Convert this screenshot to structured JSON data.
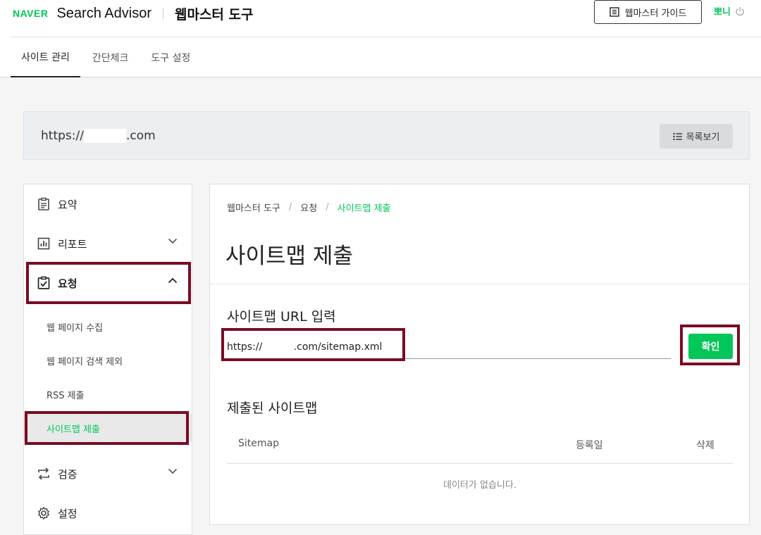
{
  "header": {
    "logo": "NAVER",
    "product": "Search Advisor",
    "section": "웹마스터 도구",
    "guide_label": "웹마스터 가이드",
    "user_name": "뽀니"
  },
  "tabs": [
    {
      "label": "사이트 관리",
      "active": true
    },
    {
      "label": "간단체크"
    },
    {
      "label": "도구 설정"
    }
  ],
  "site": {
    "url_prefix": "https://",
    "url_suffix": ".com",
    "list_button": "목록보기"
  },
  "sidebar": {
    "items": [
      {
        "label": "요약",
        "icon": "clipboard-icon"
      },
      {
        "label": "리포트",
        "icon": "chart-icon",
        "expandable": true
      },
      {
        "label": "요청",
        "icon": "checklist-icon",
        "expanded": true
      },
      {
        "label": "검증",
        "icon": "repeat-icon",
        "expandable": true
      },
      {
        "label": "설정",
        "icon": "gear-icon"
      }
    ],
    "subitems": [
      {
        "label": "웹 페이지 수집"
      },
      {
        "label": "웹 페이지 검색 제외"
      },
      {
        "label": "RSS 제출"
      },
      {
        "label": "사이트맵 제출",
        "active": true
      }
    ]
  },
  "main": {
    "breadcrumb": [
      "웹마스터 도구",
      "요청",
      "사이트맵 제출"
    ],
    "title": "사이트맵 제출",
    "input_label": "사이트맵 URL 입력",
    "input_value": "https://          .com/sitemap.xml",
    "submit_label": "확인",
    "submitted_title": "제출된 사이트맵",
    "columns": [
      "Sitemap",
      "등록일",
      "삭제"
    ],
    "empty_text": "데이터가 없습니다."
  },
  "colors": {
    "accent": "#03c75a",
    "highlight": "#7a0c22"
  }
}
